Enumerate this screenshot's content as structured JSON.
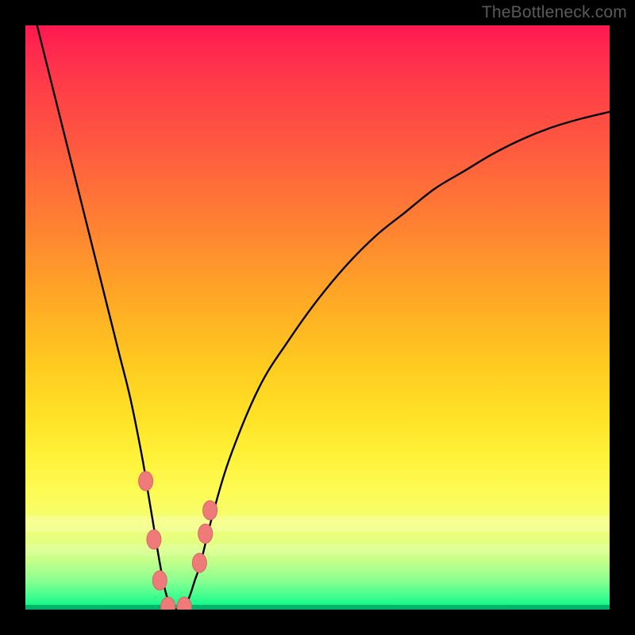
{
  "watermark": "TheBottleneck.com",
  "colors": {
    "frame": "#000000",
    "curve_stroke": "#000000",
    "marker_fill": "#ee7b79",
    "marker_stroke": "#d46866",
    "watermark": "#5a5a5a"
  },
  "chart_data": {
    "type": "line",
    "title": "",
    "xlabel": "",
    "ylabel": "",
    "xlim": [
      0,
      100
    ],
    "ylim": [
      0,
      100
    ],
    "grid": false,
    "series": [
      {
        "name": "bottleneck-curve",
        "x": [
          0,
          2,
          4,
          6,
          8,
          10,
          12,
          14,
          16,
          18,
          20,
          21,
          22,
          23,
          24,
          25,
          26,
          27,
          28,
          29,
          30,
          32,
          35,
          40,
          45,
          50,
          55,
          60,
          65,
          70,
          75,
          80,
          85,
          90,
          95,
          100
        ],
        "y": [
          108,
          100,
          92,
          84,
          76,
          68,
          60,
          52,
          44,
          36,
          26,
          20,
          14,
          8,
          3,
          0.5,
          0,
          0.5,
          2,
          5,
          8,
          16,
          26,
          38,
          46,
          53,
          59,
          64,
          68,
          72,
          75,
          78,
          80.5,
          82.5,
          84,
          85.2
        ]
      }
    ],
    "markers": [
      {
        "name": "dot-left-upper",
        "x": 20.6,
        "y": 22
      },
      {
        "name": "dot-left-mid",
        "x": 22.0,
        "y": 12
      },
      {
        "name": "dot-left-low",
        "x": 23.0,
        "y": 5
      },
      {
        "name": "dot-min-left",
        "x": 24.4,
        "y": 0.5
      },
      {
        "name": "dot-min-right",
        "x": 27.2,
        "y": 0.5
      },
      {
        "name": "dot-right-low",
        "x": 29.8,
        "y": 8
      },
      {
        "name": "dot-right-mid",
        "x": 30.8,
        "y": 13
      },
      {
        "name": "dot-right-upper",
        "x": 31.6,
        "y": 17
      }
    ],
    "marker_radius": 9
  }
}
